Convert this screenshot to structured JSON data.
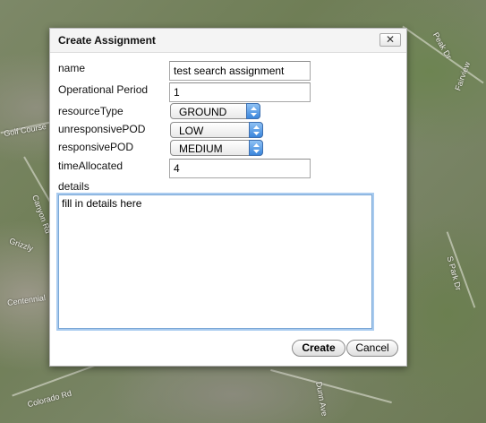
{
  "map": {
    "labels": [
      "Golf Course",
      "Canyon Rd",
      "Centennial",
      "Grizzly",
      "Colorado Rd",
      "Peak Dr",
      "S Park Dr",
      "Fairview",
      "Dunn Ave"
    ]
  },
  "dialog": {
    "title": "Create Assignment",
    "close_label": "✕"
  },
  "form": {
    "name": {
      "label": "name",
      "value": "test search assignment"
    },
    "operational_period": {
      "label": "Operational Period",
      "value": "1"
    },
    "resource_type": {
      "label": "resourceType",
      "value": "GROUND"
    },
    "unresponsive_pod": {
      "label": "unresponsivePOD",
      "value": "LOW"
    },
    "responsive_pod": {
      "label": "responsivePOD",
      "value": "MEDIUM"
    },
    "time_allocated": {
      "label": "timeAllocated",
      "value": "4"
    },
    "details": {
      "label": "details",
      "value": "fill in details here"
    }
  },
  "buttons": {
    "create": "Create",
    "cancel": "Cancel"
  },
  "colors": {
    "select_arrow_start": "#8fc1f4",
    "select_arrow_end": "#3b86dc",
    "textarea_focus": "#a9cbef"
  }
}
